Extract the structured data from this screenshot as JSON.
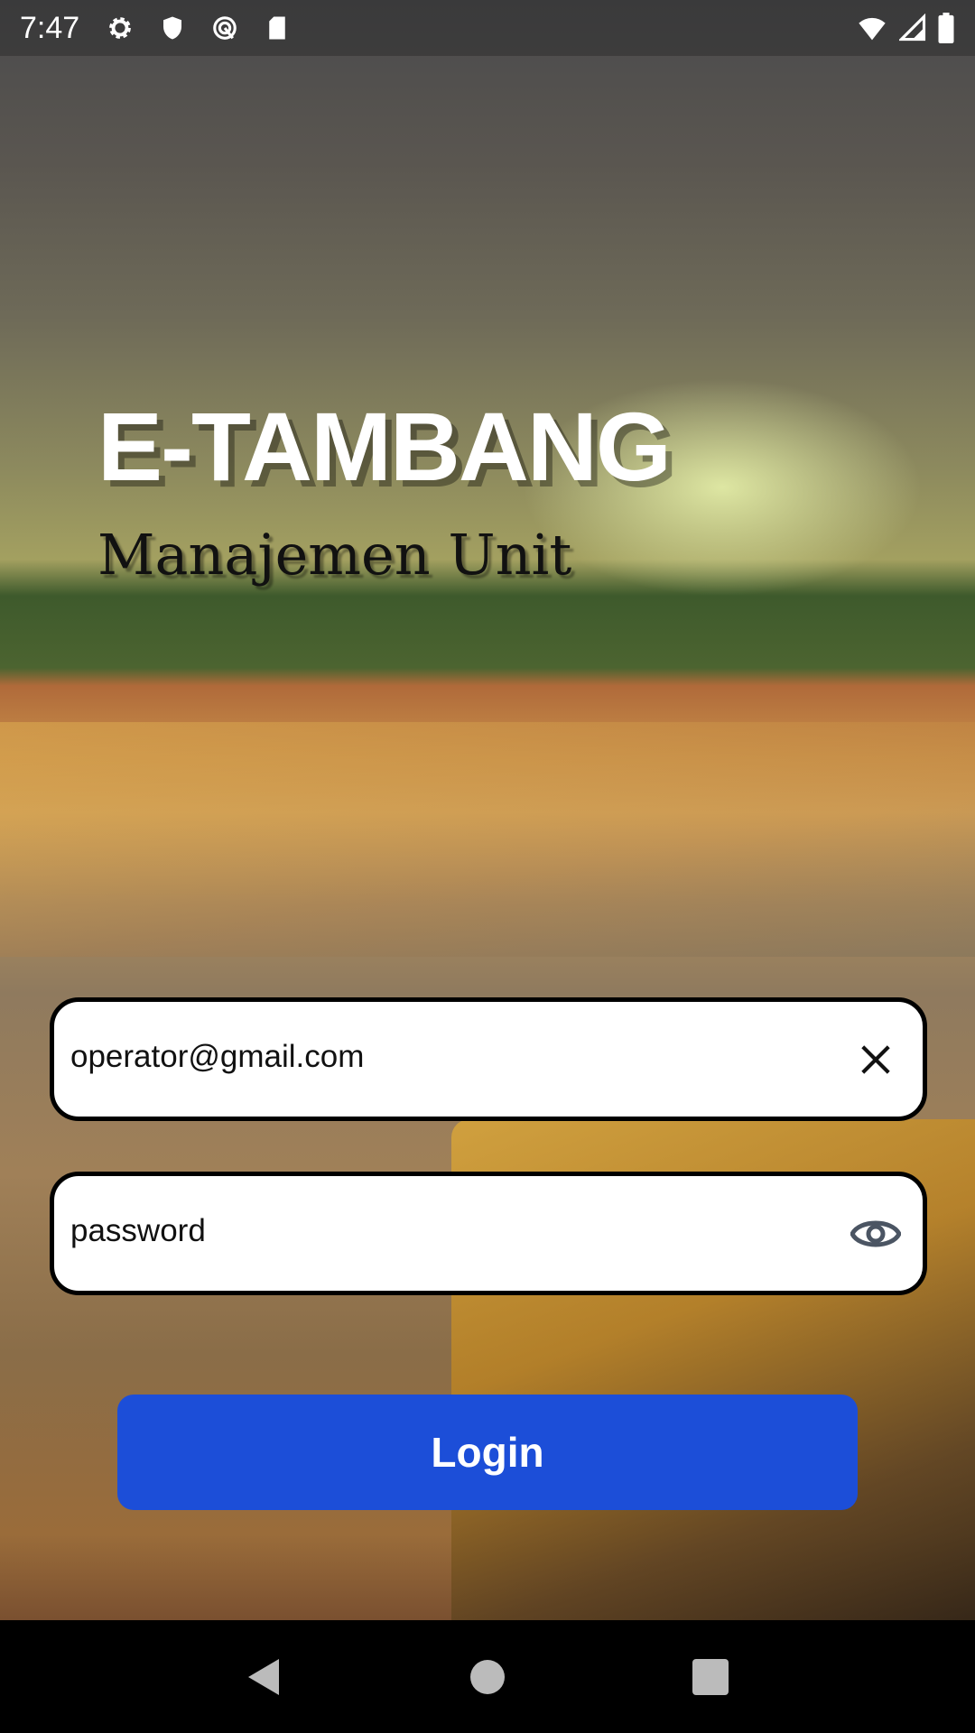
{
  "status_bar": {
    "time": "7:47",
    "icons": [
      "gear-icon",
      "shield-icon",
      "sync-icon",
      "sd-card-icon",
      "wifi-icon",
      "signal-icon",
      "battery-icon"
    ]
  },
  "app": {
    "title": "E-TAMBANG",
    "subtitle": "Manajemen Unit"
  },
  "form": {
    "email_value": "operator@gmail.com",
    "password_placeholder": "password",
    "login_label": "Login"
  },
  "colors": {
    "accent": "#1c4ed8"
  },
  "nav": {
    "icons": [
      "back-icon",
      "home-icon",
      "recents-icon"
    ]
  }
}
